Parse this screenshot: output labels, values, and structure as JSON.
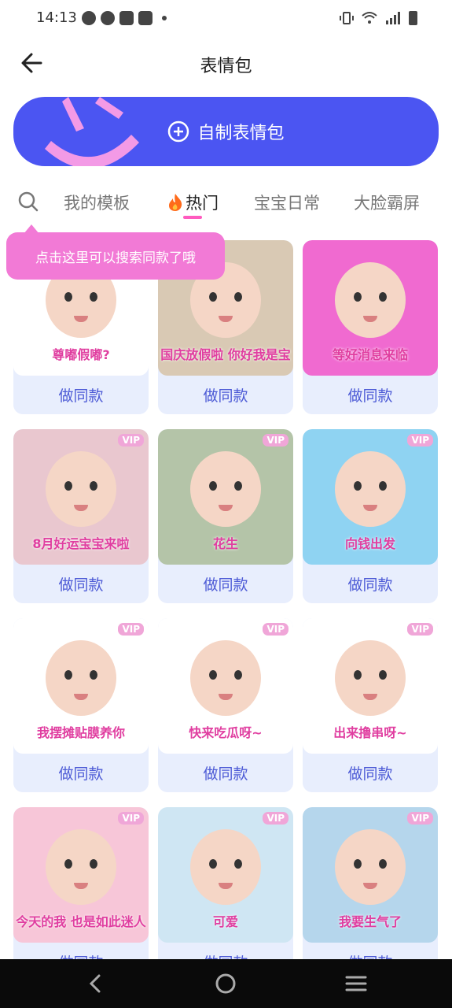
{
  "status": {
    "time": "14:13"
  },
  "header": {
    "title": "表情包"
  },
  "banner": {
    "label": "自制表情包",
    "color": "#4b55f2"
  },
  "tabs": [
    {
      "label": "我的模板",
      "active": false
    },
    {
      "label": "热门",
      "active": true,
      "icon": "fire-icon"
    },
    {
      "label": "宝宝日常",
      "active": false
    },
    {
      "label": "大脸霸屏",
      "active": false
    }
  ],
  "tooltip": {
    "text": "点击这里可以搜索同款了哦"
  },
  "grid": {
    "action_label": "做同款",
    "items": [
      {
        "caption": "尊嘟假嘟?",
        "vip": "",
        "bg": "#ffffff"
      },
      {
        "caption": "国庆放假啦 你好我是宝",
        "vip": "",
        "bg": "#d9c9b4"
      },
      {
        "caption": "等好消息来临",
        "vip": "",
        "bg": "#f06ad0"
      },
      {
        "caption": "8月好运宝宝来啦",
        "vip": "VIP",
        "bg": "#e9c7cf"
      },
      {
        "caption": "花生",
        "vip": "VIP",
        "bg": "#b4c4a8"
      },
      {
        "caption": "向钱出发",
        "vip": "VIP",
        "bg": "#8fd3f2"
      },
      {
        "caption": "我摆摊贴膜养你",
        "vip": "VIP",
        "bg": "#ffffff"
      },
      {
        "caption": "快来吃瓜呀~",
        "vip": "VIP",
        "bg": "#ffffff"
      },
      {
        "caption": "出来撸串呀~",
        "vip": "VIP",
        "bg": "#ffffff"
      },
      {
        "caption": "今天的我 也是如此迷人",
        "vip": "VIP",
        "bg": "#f7c6d8"
      },
      {
        "caption": "可爱",
        "vip": "VIP",
        "bg": "#cfe6f3"
      },
      {
        "caption": "我要生气了",
        "vip": "VIP",
        "bg": "#b5d6ec"
      }
    ]
  }
}
